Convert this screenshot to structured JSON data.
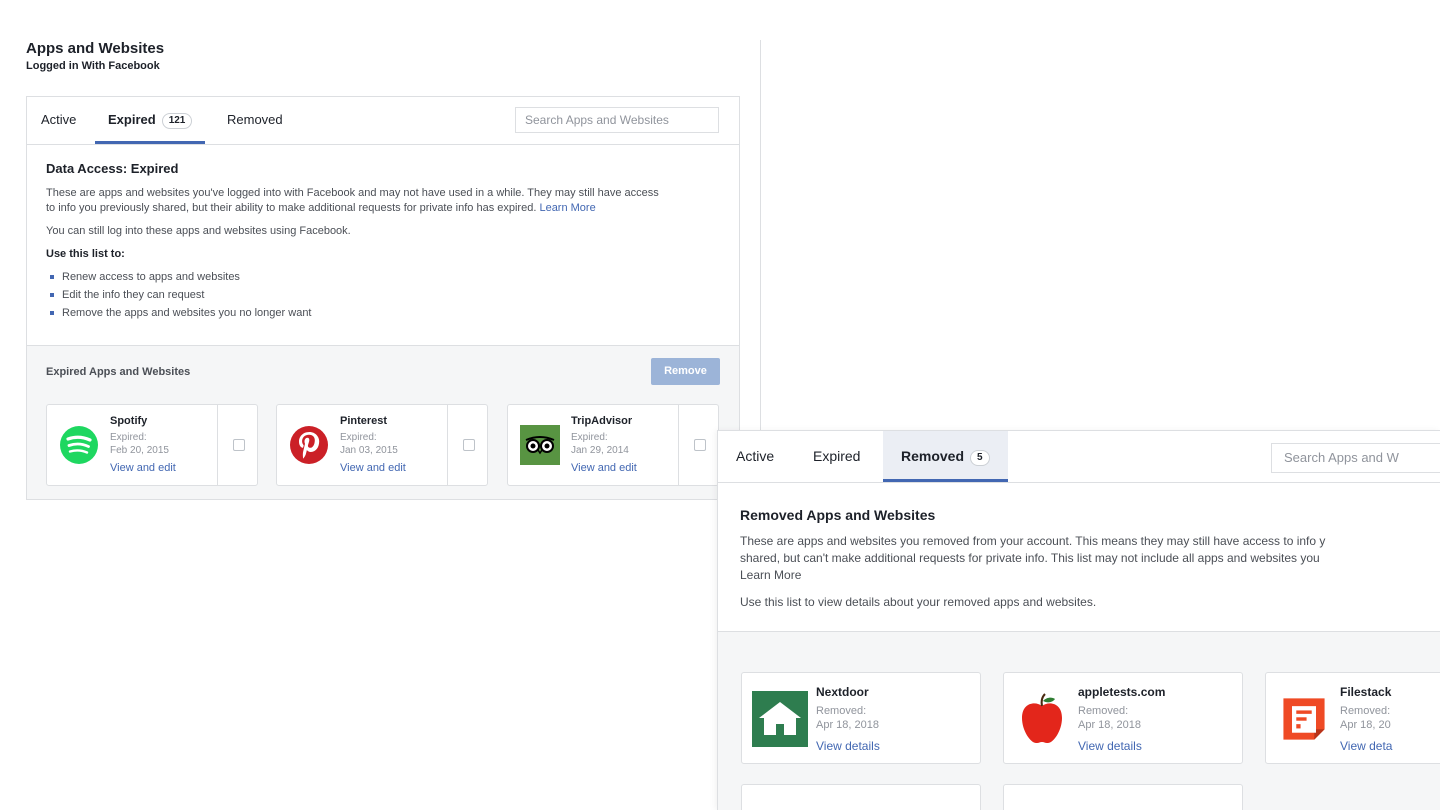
{
  "header": {
    "title": "Apps and Websites",
    "subtitle": "Logged in With Facebook"
  },
  "left_panel": {
    "tabs": [
      {
        "label": "Active"
      },
      {
        "label": "Expired",
        "count": "121"
      },
      {
        "label": "Removed"
      }
    ],
    "search_placeholder": "Search Apps and Websites",
    "section_title": "Data Access: Expired",
    "paragraph1": "These are apps and websites you've logged into with Facebook and may not have used in a while. They may still have access",
    "paragraph1b": "to info you previously shared, but their ability to make additional requests for private info has expired.",
    "learn_more": "Learn More",
    "paragraph2": "You can still log into these apps and websites using Facebook.",
    "use_list_label": "Use this list to:",
    "bullets": [
      "Renew access to apps and websites",
      "Edit the info they can request",
      "Remove the apps and websites you no longer want"
    ],
    "list_title": "Expired Apps and Websites",
    "remove_button": "Remove",
    "apps": [
      {
        "name": "Spotify",
        "status": "Expired:",
        "date": "Feb 20, 2015",
        "action": "View and edit",
        "icon": "spotify-logo"
      },
      {
        "name": "Pinterest",
        "status": "Expired:",
        "date": "Jan 03, 2015",
        "action": "View and edit",
        "icon": "pinterest-logo"
      },
      {
        "name": "TripAdvisor",
        "status": "Expired:",
        "date": "Jan 29, 2014",
        "action": "View and edit",
        "icon": "tripadvisor-logo"
      }
    ]
  },
  "right_panel": {
    "tabs": [
      {
        "label": "Active"
      },
      {
        "label": "Expired"
      },
      {
        "label": "Removed",
        "count": "5"
      }
    ],
    "search_placeholder": "Search Apps and W",
    "section_title": "Removed Apps and Websites",
    "line1": "These are apps and websites you removed from your account. This means they may still have access to info y",
    "line2": "shared, but can't make additional requests for private info. This list may not include all apps and websites you",
    "learn_more": "Learn More",
    "line3": "Use this list to view details about your removed apps and websites.",
    "apps": [
      {
        "name": "Nextdoor",
        "status": "Removed:",
        "date": "Apr 18, 2018",
        "action": "View details",
        "icon": "nextdoor-logo"
      },
      {
        "name": "appletests.com",
        "status": "Removed:",
        "date": "Apr 18, 2018",
        "action": "View details",
        "icon": "apple-logo"
      },
      {
        "name": "Filestack",
        "status": "Removed:",
        "date": "Apr 18, 20",
        "action": "View deta",
        "icon": "filestack-logo"
      }
    ]
  },
  "colors": {
    "brand": "#4267b2",
    "spotify": "#1ed760",
    "pinterest": "#cb2027",
    "tripadvisor": "#589442",
    "nextdoor": "#2e7d4f",
    "apple": "#e3261b",
    "filestack": "#ef4a25"
  }
}
